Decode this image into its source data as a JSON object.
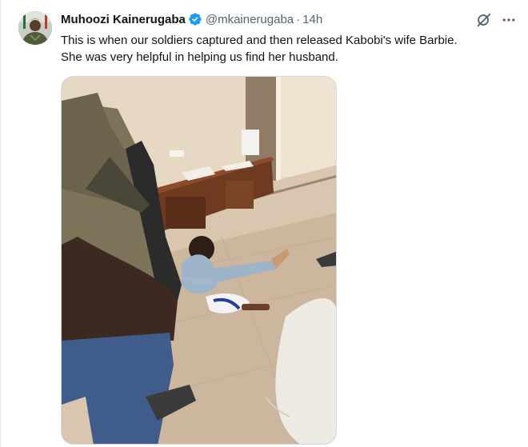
{
  "tweet": {
    "author": {
      "display_name": "Muhoozi Kainerugaba",
      "handle": "@mkainerugaba",
      "verified": true,
      "avatar_icon": "profile-avatar"
    },
    "separator": "·",
    "timestamp": "14h",
    "text_lines": [
      "This is when our soldiers captured and then released Kabobi's wife Barbie.",
      "She was very helpful in helping us find her husband."
    ],
    "media": {
      "type": "photo",
      "alt": "photo"
    },
    "actions": {
      "grok_icon": "grok-icon",
      "more_icon": "more-icon"
    }
  },
  "colors": {
    "verified_blue": "#1d9bf0",
    "secondary_text": "#536471",
    "primary_text": "#0f1419"
  }
}
